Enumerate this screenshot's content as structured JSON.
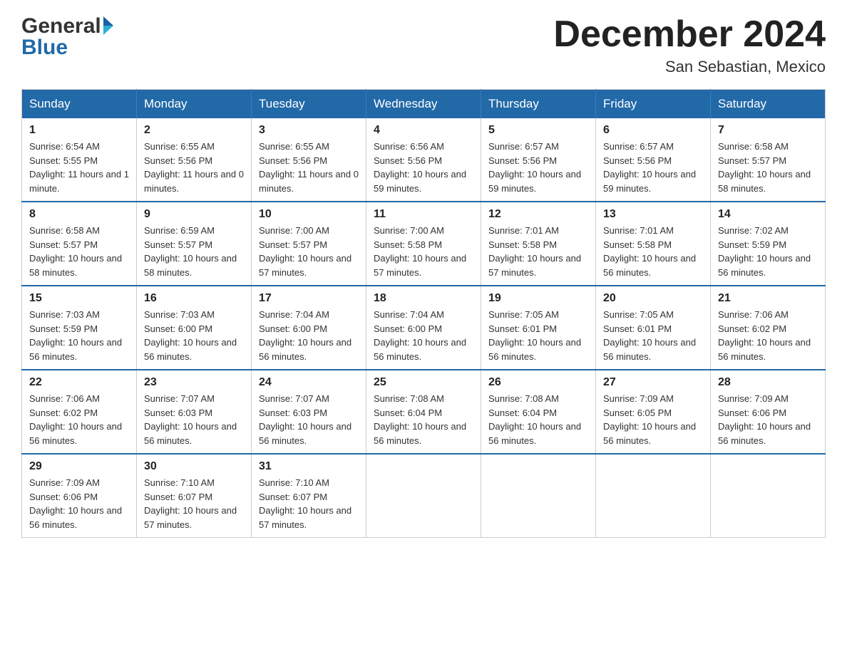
{
  "logo": {
    "general": "General",
    "blue": "Blue"
  },
  "title": {
    "month_year": "December 2024",
    "location": "San Sebastian, Mexico"
  },
  "headers": [
    "Sunday",
    "Monday",
    "Tuesday",
    "Wednesday",
    "Thursday",
    "Friday",
    "Saturday"
  ],
  "weeks": [
    [
      {
        "day": "1",
        "sunrise": "6:54 AM",
        "sunset": "5:55 PM",
        "daylight": "11 hours and 1 minute."
      },
      {
        "day": "2",
        "sunrise": "6:55 AM",
        "sunset": "5:56 PM",
        "daylight": "11 hours and 0 minutes."
      },
      {
        "day": "3",
        "sunrise": "6:55 AM",
        "sunset": "5:56 PM",
        "daylight": "11 hours and 0 minutes."
      },
      {
        "day": "4",
        "sunrise": "6:56 AM",
        "sunset": "5:56 PM",
        "daylight": "10 hours and 59 minutes."
      },
      {
        "day": "5",
        "sunrise": "6:57 AM",
        "sunset": "5:56 PM",
        "daylight": "10 hours and 59 minutes."
      },
      {
        "day": "6",
        "sunrise": "6:57 AM",
        "sunset": "5:56 PM",
        "daylight": "10 hours and 59 minutes."
      },
      {
        "day": "7",
        "sunrise": "6:58 AM",
        "sunset": "5:57 PM",
        "daylight": "10 hours and 58 minutes."
      }
    ],
    [
      {
        "day": "8",
        "sunrise": "6:58 AM",
        "sunset": "5:57 PM",
        "daylight": "10 hours and 58 minutes."
      },
      {
        "day": "9",
        "sunrise": "6:59 AM",
        "sunset": "5:57 PM",
        "daylight": "10 hours and 58 minutes."
      },
      {
        "day": "10",
        "sunrise": "7:00 AM",
        "sunset": "5:57 PM",
        "daylight": "10 hours and 57 minutes."
      },
      {
        "day": "11",
        "sunrise": "7:00 AM",
        "sunset": "5:58 PM",
        "daylight": "10 hours and 57 minutes."
      },
      {
        "day": "12",
        "sunrise": "7:01 AM",
        "sunset": "5:58 PM",
        "daylight": "10 hours and 57 minutes."
      },
      {
        "day": "13",
        "sunrise": "7:01 AM",
        "sunset": "5:58 PM",
        "daylight": "10 hours and 56 minutes."
      },
      {
        "day": "14",
        "sunrise": "7:02 AM",
        "sunset": "5:59 PM",
        "daylight": "10 hours and 56 minutes."
      }
    ],
    [
      {
        "day": "15",
        "sunrise": "7:03 AM",
        "sunset": "5:59 PM",
        "daylight": "10 hours and 56 minutes."
      },
      {
        "day": "16",
        "sunrise": "7:03 AM",
        "sunset": "6:00 PM",
        "daylight": "10 hours and 56 minutes."
      },
      {
        "day": "17",
        "sunrise": "7:04 AM",
        "sunset": "6:00 PM",
        "daylight": "10 hours and 56 minutes."
      },
      {
        "day": "18",
        "sunrise": "7:04 AM",
        "sunset": "6:00 PM",
        "daylight": "10 hours and 56 minutes."
      },
      {
        "day": "19",
        "sunrise": "7:05 AM",
        "sunset": "6:01 PM",
        "daylight": "10 hours and 56 minutes."
      },
      {
        "day": "20",
        "sunrise": "7:05 AM",
        "sunset": "6:01 PM",
        "daylight": "10 hours and 56 minutes."
      },
      {
        "day": "21",
        "sunrise": "7:06 AM",
        "sunset": "6:02 PM",
        "daylight": "10 hours and 56 minutes."
      }
    ],
    [
      {
        "day": "22",
        "sunrise": "7:06 AM",
        "sunset": "6:02 PM",
        "daylight": "10 hours and 56 minutes."
      },
      {
        "day": "23",
        "sunrise": "7:07 AM",
        "sunset": "6:03 PM",
        "daylight": "10 hours and 56 minutes."
      },
      {
        "day": "24",
        "sunrise": "7:07 AM",
        "sunset": "6:03 PM",
        "daylight": "10 hours and 56 minutes."
      },
      {
        "day": "25",
        "sunrise": "7:08 AM",
        "sunset": "6:04 PM",
        "daylight": "10 hours and 56 minutes."
      },
      {
        "day": "26",
        "sunrise": "7:08 AM",
        "sunset": "6:04 PM",
        "daylight": "10 hours and 56 minutes."
      },
      {
        "day": "27",
        "sunrise": "7:09 AM",
        "sunset": "6:05 PM",
        "daylight": "10 hours and 56 minutes."
      },
      {
        "day": "28",
        "sunrise": "7:09 AM",
        "sunset": "6:06 PM",
        "daylight": "10 hours and 56 minutes."
      }
    ],
    [
      {
        "day": "29",
        "sunrise": "7:09 AM",
        "sunset": "6:06 PM",
        "daylight": "10 hours and 56 minutes."
      },
      {
        "day": "30",
        "sunrise": "7:10 AM",
        "sunset": "6:07 PM",
        "daylight": "10 hours and 57 minutes."
      },
      {
        "day": "31",
        "sunrise": "7:10 AM",
        "sunset": "6:07 PM",
        "daylight": "10 hours and 57 minutes."
      },
      null,
      null,
      null,
      null
    ]
  ]
}
